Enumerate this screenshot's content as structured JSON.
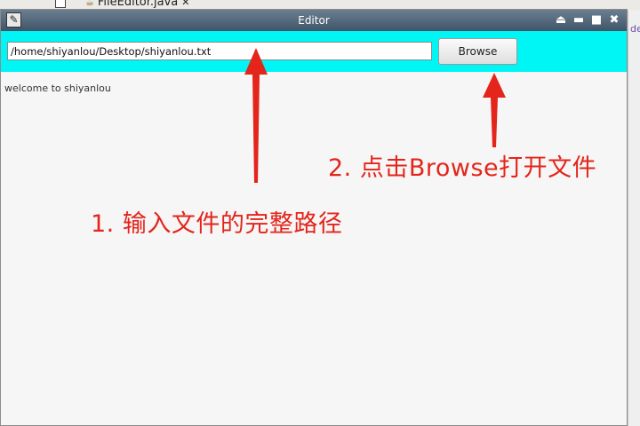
{
  "background_ide": {
    "tab_label": "FileEditor.java",
    "tab_icon": "java-file-icon",
    "tab_close": "✕",
    "side_glyph": "de"
  },
  "window": {
    "title": "Editor",
    "app_icon": "java-app-icon",
    "controls": {
      "eject": "⏏",
      "minimize": "▬",
      "maximize": "■",
      "close": "✖"
    }
  },
  "toolbar": {
    "path_value": "/home/shiyanlou/Desktop/shiyanlou.txt",
    "browse_label": "Browse"
  },
  "content": {
    "text": "welcome to shiyanlou"
  },
  "annotations": {
    "step1": "1. 输入文件的完整路径",
    "step2": "2. 点击Browse打开文件",
    "color": "#e3251b"
  },
  "colors": {
    "toolbar_bg": "#00f5f5",
    "titlebar_bg": "#4a5f72"
  }
}
